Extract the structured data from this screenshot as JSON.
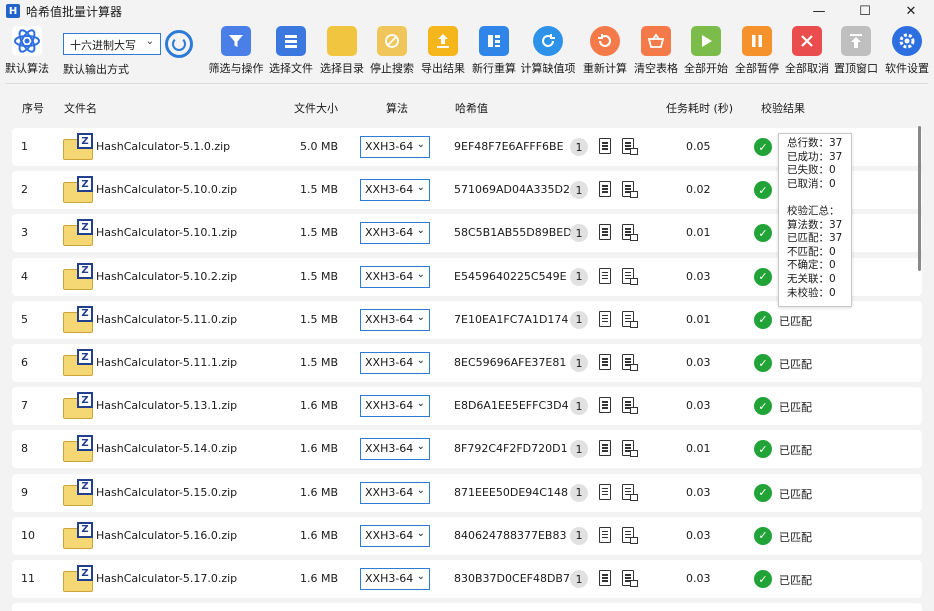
{
  "window": {
    "title": "哈希值批量计算器",
    "logo": "H",
    "minimize": "—",
    "maximize": "☐",
    "close": "✕"
  },
  "toolbar": {
    "default_algo_label": "默认算法",
    "output_format": {
      "value": "十六进制大写",
      "label": "默认输出方式"
    },
    "buttons": [
      {
        "label": "筛选与操作",
        "icon": "filter-icon",
        "color": "#4a7fe8"
      },
      {
        "label": "选择文件",
        "icon": "file-list-icon",
        "color": "#3a78e0"
      },
      {
        "label": "选择目录",
        "icon": "folder-icon",
        "color": "#f2c540"
      },
      {
        "label": "停止搜索",
        "icon": "stop-icon",
        "color": "#f0c65a"
      },
      {
        "label": "导出结果",
        "icon": "export-icon",
        "color": "#f5b61b"
      },
      {
        "label": "新行重算",
        "icon": "new-row-icon",
        "color": "#2f86e8"
      },
      {
        "label": "计算缺值项",
        "icon": "calc-missing-icon",
        "color": "#2d92e8"
      },
      {
        "label": "重新计算",
        "icon": "recalc-icon",
        "color": "#f47a4a"
      },
      {
        "label": "清空表格",
        "icon": "basket-icon",
        "color": "#f47a4a"
      },
      {
        "label": "全部开始",
        "icon": "play-icon",
        "color": "#7cbc4a"
      },
      {
        "label": "全部暂停",
        "icon": "pause-icon",
        "color": "#f5922b"
      },
      {
        "label": "全部取消",
        "icon": "cancel-icon",
        "color": "#ea4d4d"
      },
      {
        "label": "置顶窗口",
        "icon": "pin-top-icon",
        "color": "#bfbfbf"
      },
      {
        "label": "软件设置",
        "icon": "gear-icon",
        "color": "#2d6fe0"
      }
    ]
  },
  "table": {
    "headers": {
      "index": "序号",
      "name": "文件名",
      "size": "文件大小",
      "algo": "算法",
      "hash": "哈希值",
      "time": "任务耗时 (秒)",
      "result": "校验结果"
    },
    "rows": [
      {
        "index": "1",
        "name": "HashCalculator-5.1.0.zip",
        "size": "5.0 MB",
        "algo": "XXH3-64",
        "hash": "9EF48F7E6AFFF6BE",
        "count": "1",
        "time": "0.05",
        "result": ""
      },
      {
        "index": "2",
        "name": "HashCalculator-5.10.0.zip",
        "size": "1.5 MB",
        "algo": "XXH3-64",
        "hash": "571069AD04A335D2",
        "count": "1",
        "time": "0.02",
        "result": ""
      },
      {
        "index": "3",
        "name": "HashCalculator-5.10.1.zip",
        "size": "1.5 MB",
        "algo": "XXH3-64",
        "hash": "58C5B1AB55D89BED",
        "count": "1",
        "time": "0.01",
        "result": ""
      },
      {
        "index": "4",
        "name": "HashCalculator-5.10.2.zip",
        "size": "1.5 MB",
        "algo": "XXH3-64",
        "hash": "E5459640225C549E",
        "count": "1",
        "time": "0.03",
        "result": ""
      },
      {
        "index": "5",
        "name": "HashCalculator-5.11.0.zip",
        "size": "1.5 MB",
        "algo": "XXH3-64",
        "hash": "7E10EA1FC7A1D174",
        "count": "1",
        "time": "0.01",
        "result": "已匹配"
      },
      {
        "index": "6",
        "name": "HashCalculator-5.11.1.zip",
        "size": "1.5 MB",
        "algo": "XXH3-64",
        "hash": "8EC59696AFE37E81",
        "count": "1",
        "time": "0.03",
        "result": "已匹配"
      },
      {
        "index": "7",
        "name": "HashCalculator-5.13.1.zip",
        "size": "1.6 MB",
        "algo": "XXH3-64",
        "hash": "E8D6A1EE5EFFC3D4",
        "count": "1",
        "time": "0.03",
        "result": "已匹配"
      },
      {
        "index": "8",
        "name": "HashCalculator-5.14.0.zip",
        "size": "1.6 MB",
        "algo": "XXH3-64",
        "hash": "8F792C4F2FD720D1",
        "count": "1",
        "time": "0.01",
        "result": "已匹配"
      },
      {
        "index": "9",
        "name": "HashCalculator-5.15.0.zip",
        "size": "1.6 MB",
        "algo": "XXH3-64",
        "hash": "871EEE50DE94C148",
        "count": "1",
        "time": "0.03",
        "result": "已匹配"
      },
      {
        "index": "10",
        "name": "HashCalculator-5.16.0.zip",
        "size": "1.6 MB",
        "algo": "XXH3-64",
        "hash": "840624788377EB83",
        "count": "1",
        "time": "0.03",
        "result": "已匹配"
      },
      {
        "index": "11",
        "name": "HashCalculator-5.17.0.zip",
        "size": "1.6 MB",
        "algo": "XXH3-64",
        "hash": "830B37D0CEF48DB7",
        "count": "1",
        "time": "0.03",
        "result": "已匹配"
      }
    ]
  },
  "tooltip": {
    "lines": [
      "总行数：37",
      "已成功：37",
      "已失败：0",
      "已取消：0",
      "",
      "校验汇总：",
      "算法数：37",
      "已匹配：37",
      "不匹配：0",
      "不确定：0",
      "无关联：0",
      "未校验：0"
    ]
  }
}
